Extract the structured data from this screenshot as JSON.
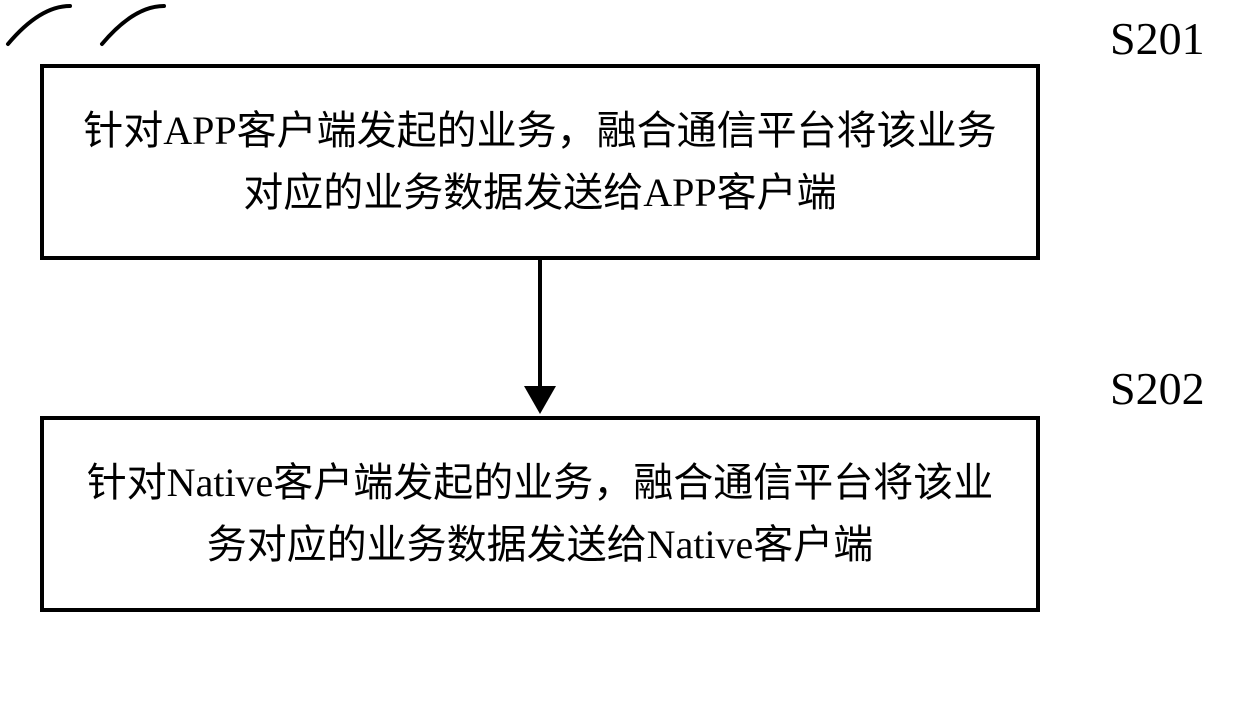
{
  "diagram": {
    "type": "flowchart",
    "steps": [
      {
        "id": "S201",
        "label": "S201",
        "text": "针对APP客户端发起的业务，融合通信平台将该业务对应的业务数据发送给APP客户端"
      },
      {
        "id": "S202",
        "label": "S202",
        "text": "针对Native客户端发起的业务，融合通信平台将该业务对应的业务数据发送给Native客户端"
      }
    ],
    "edges": [
      {
        "from": "S201",
        "to": "S202",
        "style": "arrow-down"
      }
    ]
  }
}
